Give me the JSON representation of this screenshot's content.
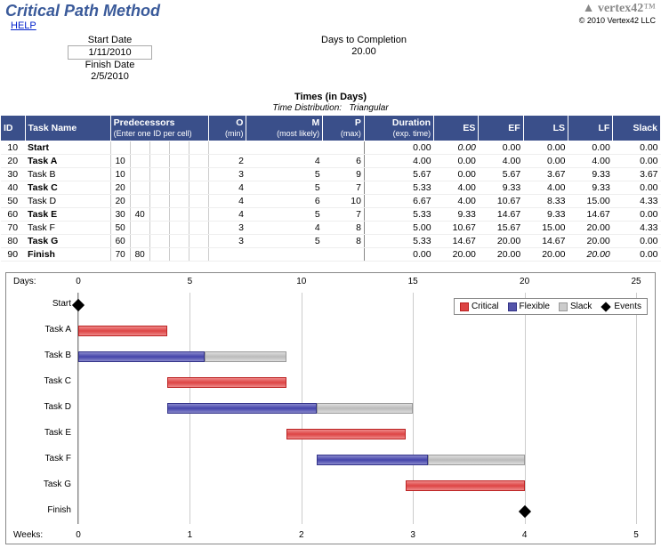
{
  "title": "Critical Path Method",
  "logo_text": "vertex42",
  "copyright": "© 2010 Vertex42 LLC",
  "help_label": "HELP",
  "info": {
    "start_label": "Start Date",
    "start_value": "1/11/2010",
    "finish_label": "Finish Date",
    "finish_value": "2/5/2010",
    "days_label": "Days to Completion",
    "days_value": "20.00"
  },
  "times_head": "Times (in Days)",
  "times_sub_label": "Time Distribution:",
  "times_sub_value": "Triangular",
  "columns": {
    "id": "ID",
    "taskname": "Task Name",
    "pred": "Predecessors",
    "pred_sub": "(Enter one ID per cell)",
    "o": "O",
    "o_sub": "(min)",
    "m": "M",
    "m_sub": "(most likely)",
    "p": "P",
    "p_sub": "(max)",
    "dur": "Duration",
    "dur_sub": "(exp. time)",
    "es": "ES",
    "ef": "EF",
    "ls": "LS",
    "lf": "LF",
    "slack": "Slack"
  },
  "rows": [
    {
      "id": "10",
      "name": "Start",
      "bold": true,
      "preds": [
        "",
        "",
        "",
        "",
        ""
      ],
      "o": "",
      "m": "",
      "p": "",
      "dur": "0.00",
      "es": "0.00",
      "es_ital": true,
      "ef": "0.00",
      "ls": "0.00",
      "lf": "0.00",
      "slack": "0.00"
    },
    {
      "id": "20",
      "name": "Task A",
      "bold": true,
      "preds": [
        "10",
        "",
        "",
        "",
        ""
      ],
      "o": "2",
      "m": "4",
      "p": "6",
      "dur": "4.00",
      "es": "0.00",
      "ef": "4.00",
      "ls": "0.00",
      "lf": "4.00",
      "slack": "0.00"
    },
    {
      "id": "30",
      "name": "Task B",
      "preds": [
        "10",
        "",
        "",
        "",
        ""
      ],
      "o": "3",
      "m": "5",
      "p": "9",
      "dur": "5.67",
      "es": "0.00",
      "ef": "5.67",
      "ls": "3.67",
      "lf": "9.33",
      "slack": "3.67"
    },
    {
      "id": "40",
      "name": "Task C",
      "bold": true,
      "preds": [
        "20",
        "",
        "",
        "",
        ""
      ],
      "o": "4",
      "m": "5",
      "p": "7",
      "dur": "5.33",
      "es": "4.00",
      "ef": "9.33",
      "ls": "4.00",
      "lf": "9.33",
      "slack": "0.00"
    },
    {
      "id": "50",
      "name": "Task D",
      "preds": [
        "20",
        "",
        "",
        "",
        ""
      ],
      "o": "4",
      "m": "6",
      "p": "10",
      "dur": "6.67",
      "es": "4.00",
      "ef": "10.67",
      "ls": "8.33",
      "lf": "15.00",
      "slack": "4.33"
    },
    {
      "id": "60",
      "name": "Task E",
      "bold": true,
      "preds": [
        "30",
        "40",
        "",
        "",
        ""
      ],
      "o": "4",
      "m": "5",
      "p": "7",
      "dur": "5.33",
      "es": "9.33",
      "ef": "14.67",
      "ls": "9.33",
      "lf": "14.67",
      "slack": "0.00"
    },
    {
      "id": "70",
      "name": "Task F",
      "preds": [
        "50",
        "",
        "",
        "",
        ""
      ],
      "o": "3",
      "m": "4",
      "p": "8",
      "dur": "5.00",
      "es": "10.67",
      "ef": "15.67",
      "ls": "15.00",
      "lf": "20.00",
      "slack": "4.33"
    },
    {
      "id": "80",
      "name": "Task G",
      "bold": true,
      "preds": [
        "60",
        "",
        "",
        "",
        ""
      ],
      "o": "3",
      "m": "5",
      "p": "8",
      "dur": "5.33",
      "es": "14.67",
      "ef": "20.00",
      "ls": "14.67",
      "lf": "20.00",
      "slack": "0.00"
    },
    {
      "id": "90",
      "name": "Finish",
      "bold": true,
      "preds": [
        "70",
        "80",
        "",
        "",
        ""
      ],
      "o": "",
      "m": "",
      "p": "",
      "dur": "0.00",
      "es": "20.00",
      "ef": "20.00",
      "ls": "20.00",
      "lf": "20.00",
      "lf_ital": true,
      "slack": "0.00"
    }
  ],
  "chart_data": {
    "type": "bar",
    "x_axis_top_label": "Days:",
    "x_axis_bot_label": "Weeks:",
    "top_ticks": [
      0,
      5,
      10,
      15,
      20,
      25
    ],
    "bot_ticks": [
      0,
      1,
      2,
      3,
      4,
      5
    ],
    "legend": {
      "crit": "Critical",
      "flex": "Flexible",
      "slack": "Slack",
      "events": "Events"
    },
    "xlim": [
      0,
      25
    ],
    "series": [
      {
        "name": "Start",
        "type": "event",
        "at": 0
      },
      {
        "name": "Task A",
        "type": "critical",
        "es": 0,
        "ef": 4,
        "lf": 4
      },
      {
        "name": "Task B",
        "type": "flexible",
        "es": 0,
        "ef": 5.67,
        "lf": 9.33
      },
      {
        "name": "Task C",
        "type": "critical",
        "es": 4,
        "ef": 9.33,
        "lf": 9.33
      },
      {
        "name": "Task D",
        "type": "flexible",
        "es": 4,
        "ef": 10.67,
        "lf": 15
      },
      {
        "name": "Task E",
        "type": "critical",
        "es": 9.33,
        "ef": 14.67,
        "lf": 14.67
      },
      {
        "name": "Task F",
        "type": "flexible",
        "es": 10.67,
        "ef": 15.67,
        "lf": 20
      },
      {
        "name": "Task G",
        "type": "critical",
        "es": 14.67,
        "ef": 20,
        "lf": 20
      },
      {
        "name": "Finish",
        "type": "event",
        "at": 20
      }
    ]
  }
}
